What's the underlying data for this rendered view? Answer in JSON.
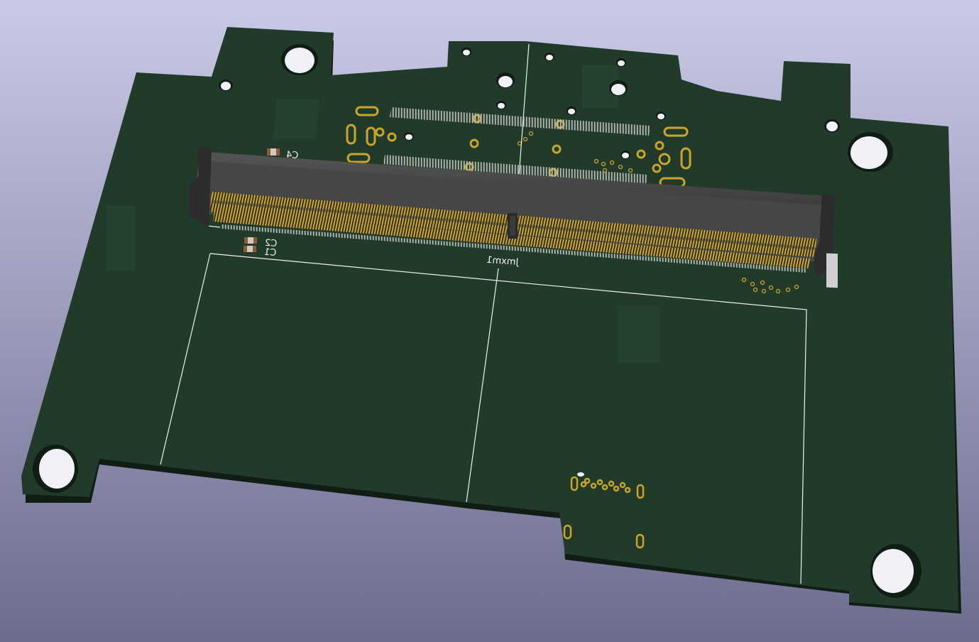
{
  "viewer": {
    "colors": {
      "background_top": "#c9cae6",
      "background_bottom": "#6c6c8e",
      "board": "#213a29",
      "board_edge": "#0f1d14",
      "board_shade": "#2a4a33",
      "silkscreen": "#f0f0f0",
      "copper_gold": "#c9a52a",
      "connector_body": "#464646",
      "connector_dark": "#2a2a2a",
      "pad_silver": "#b8bdb8",
      "hole": "#f0f0f6",
      "component_body": "#cfc8bc"
    }
  },
  "board": {
    "reference_labels": {
      "connector": "Jmxm1",
      "cap_c1": "C1",
      "cap_c2": "C2",
      "cap_c4": "C4"
    }
  }
}
